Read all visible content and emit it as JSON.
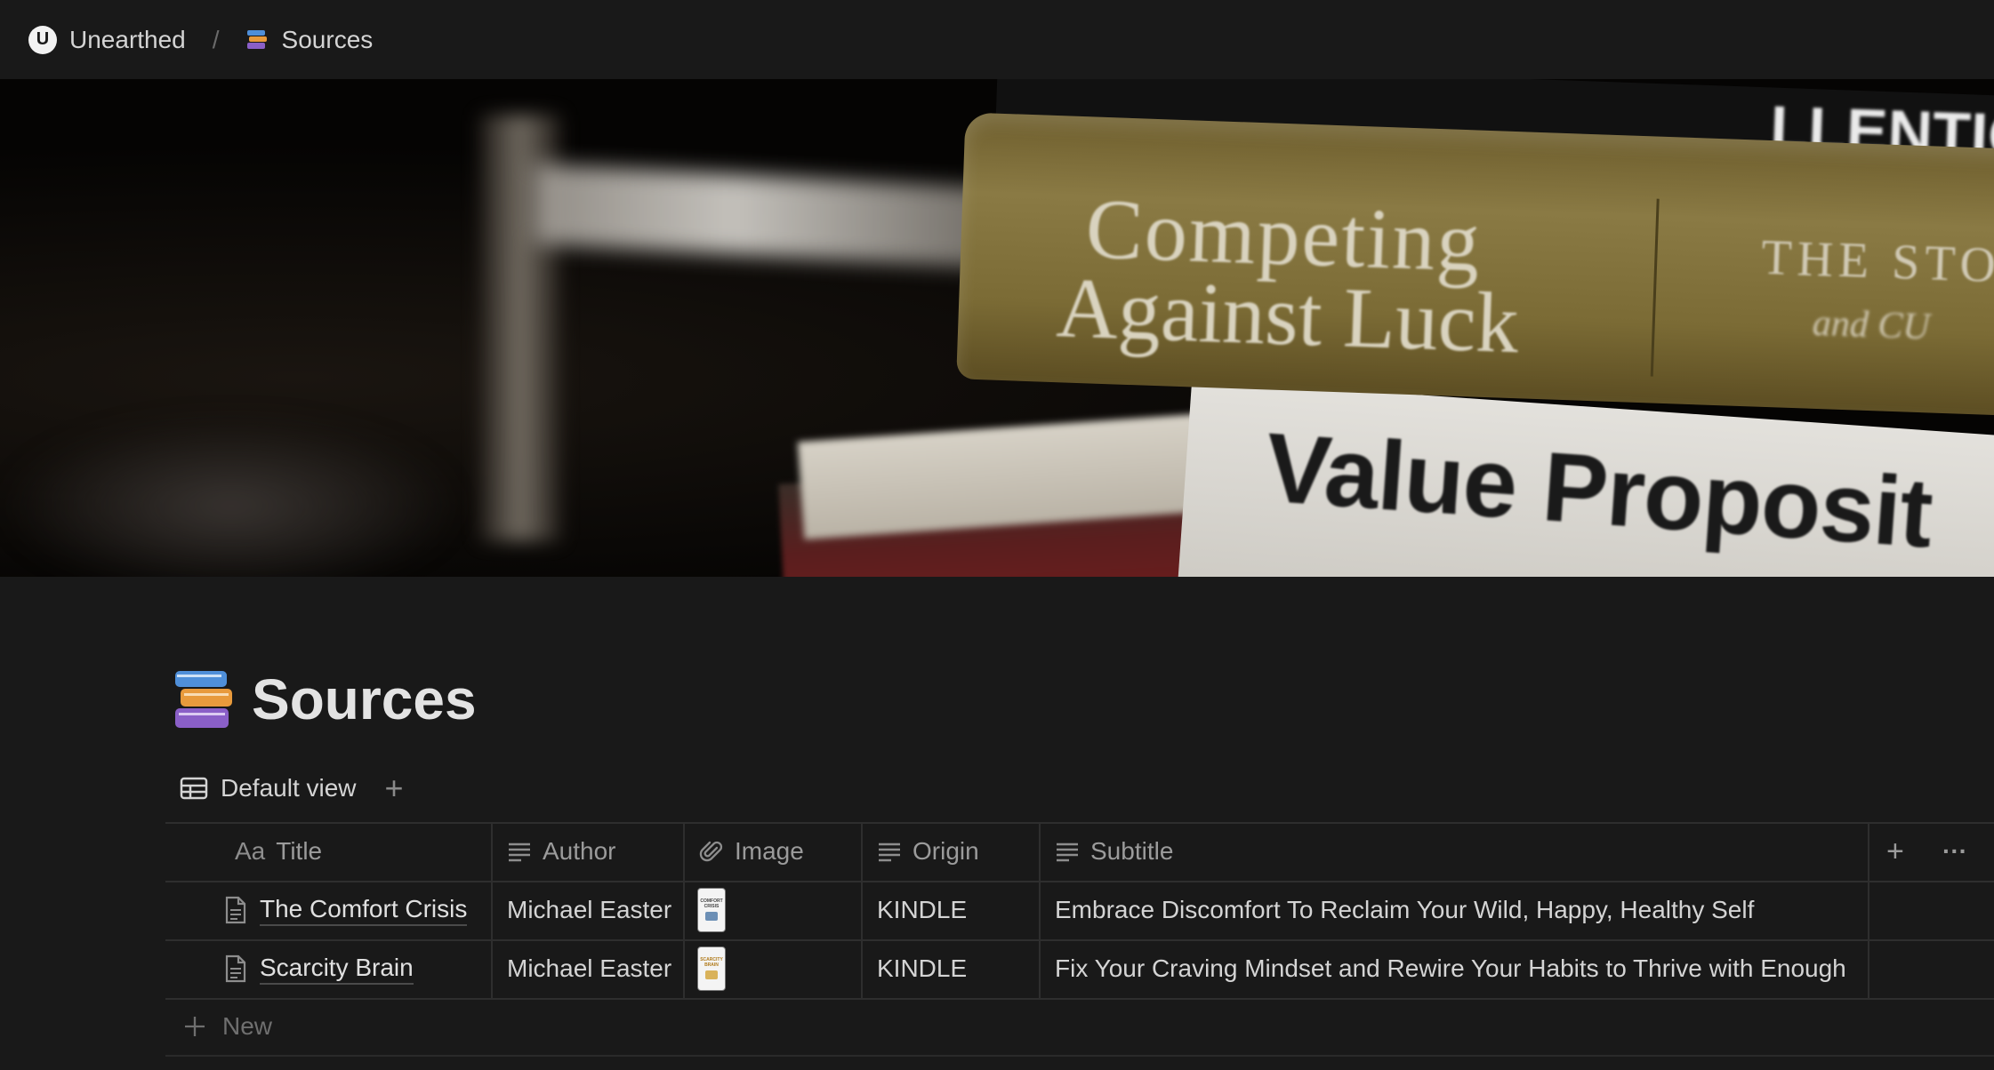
{
  "breadcrumb": {
    "workspace": "Unearthed",
    "workspace_logo": "U",
    "separator": "/",
    "page": "Sources"
  },
  "cover": {
    "book1_line1": "Competing",
    "book1_line2": "Against Luck",
    "book1_side_line1": "THE STO",
    "book1_side_line2": "and CU",
    "book2": "Value Proposit",
    "book_top": "LLENTIO"
  },
  "page": {
    "title": "Sources",
    "icon": "books-icon"
  },
  "view": {
    "label": "Default view",
    "add_label": "+"
  },
  "table": {
    "columns": [
      {
        "label": "Title",
        "icon": "Aa"
      },
      {
        "label": "Author",
        "icon": "text-lines-icon"
      },
      {
        "label": "Image",
        "icon": "paperclip-icon"
      },
      {
        "label": "Origin",
        "icon": "text-lines-icon"
      },
      {
        "label": "Subtitle",
        "icon": "text-lines-icon"
      }
    ],
    "add_column": "+",
    "more": "···",
    "rows": [
      {
        "title": "The Comfort Crisis",
        "author": "Michael Easter",
        "image_caption": "COMFORT CRISIS",
        "origin": "KINDLE",
        "subtitle": "Embrace Discomfort To Reclaim Your Wild, Happy, Healthy Self"
      },
      {
        "title": "Scarcity Brain",
        "author": "Michael Easter",
        "image_caption": "SCARCITY BRAIN",
        "origin": "KINDLE",
        "subtitle": "Fix Your Craving Mindset and Rewire Your Habits to Thrive with Enough"
      }
    ],
    "new_label": "New"
  },
  "colors": {
    "background": "#191919",
    "text": "#d4d4d4",
    "muted": "#9b9b9b",
    "border": "#2e2e2e"
  }
}
